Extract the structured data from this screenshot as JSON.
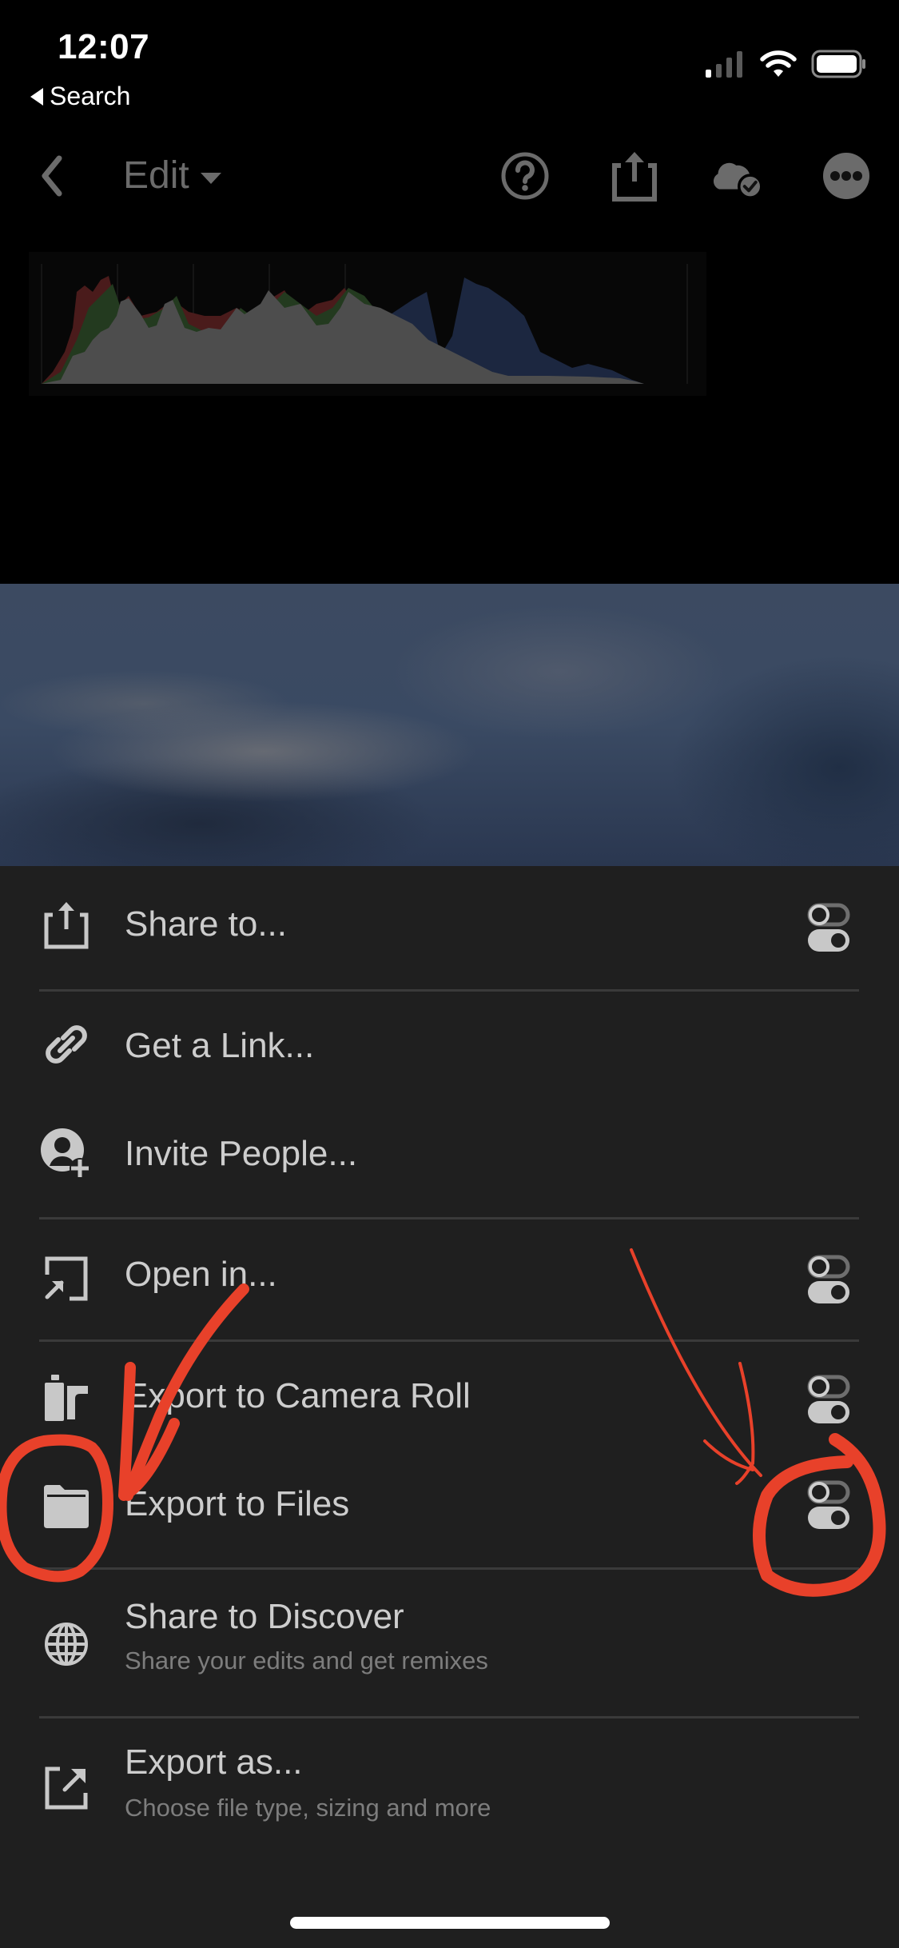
{
  "status_bar": {
    "time": "12:07",
    "back_label": "Search",
    "icons": [
      "cellular-signal-icon",
      "wifi-icon",
      "battery-icon"
    ]
  },
  "toolbar": {
    "back_icon": "chevron-left-icon",
    "mode_label": "Edit",
    "mode_dropdown_icon": "caret-down-icon",
    "actions": [
      {
        "name": "help",
        "icon": "question-circle-icon"
      },
      {
        "name": "share",
        "icon": "share-upload-icon"
      },
      {
        "name": "cloud-sync",
        "icon": "cloud-check-icon"
      },
      {
        "name": "more",
        "icon": "more-dots-icon"
      }
    ]
  },
  "histogram": {
    "channels": [
      "red",
      "green",
      "blue",
      "luminance"
    ]
  },
  "share_sheet": {
    "items": [
      {
        "label": "Share to...",
        "icon": "share-upload-icon",
        "has_settings_toggle": true
      },
      {
        "label": "Get a Link...",
        "icon": "link-icon",
        "has_settings_toggle": false
      },
      {
        "label": "Invite People...",
        "icon": "invite-person-icon",
        "has_settings_toggle": false
      },
      {
        "label": "Open in...",
        "icon": "open-in-icon",
        "has_settings_toggle": true
      },
      {
        "label": "Export to Camera Roll",
        "icon": "camera-roll-icon",
        "has_settings_toggle": true
      },
      {
        "label": "Export to Files",
        "icon": "folder-icon",
        "has_settings_toggle": true
      },
      {
        "label": "Share to Discover",
        "sublabel": "Share your edits and get remixes",
        "icon": "globe-icon",
        "has_settings_toggle": false
      },
      {
        "label": "Export as...",
        "sublabel": "Choose file type, sizing and more",
        "icon": "export-as-icon",
        "has_settings_toggle": false
      }
    ]
  },
  "annotation_color": "#e8412a",
  "colors": {
    "sheet_background": "#1f1f1f",
    "item_text": "#cdcdcd",
    "sublabel_text": "#7d7d7d",
    "separator": "#3a3a3a",
    "toolbar_icon": "#6b6b6b"
  }
}
